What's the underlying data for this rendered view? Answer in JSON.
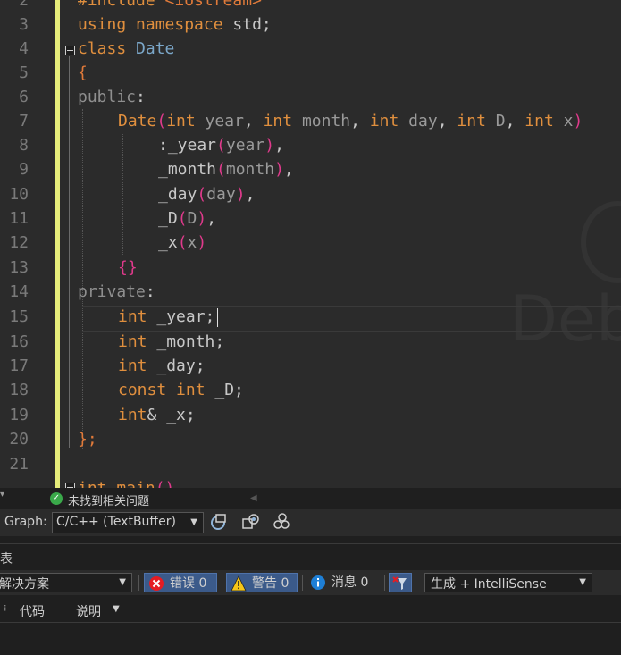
{
  "editor": {
    "lines": [
      {
        "n": "2"
      },
      {
        "n": "3"
      },
      {
        "n": "4"
      },
      {
        "n": "5"
      },
      {
        "n": "6"
      },
      {
        "n": "7"
      },
      {
        "n": "8"
      },
      {
        "n": "9"
      },
      {
        "n": "10"
      },
      {
        "n": "11"
      },
      {
        "n": "12"
      },
      {
        "n": "13"
      },
      {
        "n": "14"
      },
      {
        "n": "15"
      },
      {
        "n": "16"
      },
      {
        "n": "17"
      },
      {
        "n": "18"
      },
      {
        "n": "19"
      },
      {
        "n": "20"
      },
      {
        "n": "21"
      }
    ],
    "tokens": {
      "l2_a": "#include",
      "l2_b": " <iostream>",
      "l3_a": "using",
      "l3_b": " namespace",
      "l3_c": " std;",
      "l4_a": "class",
      "l4_b": " Date",
      "l5_a": "{",
      "l6_a": "public",
      "l6_b": ":",
      "l7_a": "Date",
      "l7_b": "(",
      "l7_c": "int",
      "l7_d": " year",
      "l7_e": ", ",
      "l7_f": "int",
      "l7_g": " month",
      "l7_h": ", ",
      "l7_i": "int",
      "l7_j": " day",
      "l7_k": ", ",
      "l7_l": "int",
      "l7_m": " D",
      "l7_n": ", ",
      "l7_o": "int",
      "l7_p": " x",
      "l7_q": ")",
      "l8_a": ":_year",
      "l8_b": "(",
      "l8_c": "year",
      "l8_d": ")",
      "l8_e": ",",
      "l9_a": "_month",
      "l9_b": "(",
      "l9_c": "month",
      "l9_d": ")",
      "l9_e": ",",
      "l10_a": "_day",
      "l10_b": "(",
      "l10_c": "day",
      "l10_d": ")",
      "l10_e": ",",
      "l11_a": "_D",
      "l11_b": "(",
      "l11_c": "D",
      "l11_d": ")",
      "l11_e": ",",
      "l12_a": "_x",
      "l12_b": "(",
      "l12_c": "x",
      "l12_d": ")",
      "l13_a": "{}",
      "l14_a": "private",
      "l14_b": ":",
      "l15_a": "int",
      "l15_b": " _year;",
      "l16_a": "int",
      "l16_b": " _month;",
      "l17_a": "int",
      "l17_b": " _day;",
      "l18_a": "const",
      "l18_b": " int",
      "l18_c": " _D;",
      "l19_a": "int",
      "l19_b": "&",
      "l19_c": " _x;",
      "l20_a": "};",
      "l22_a": "int",
      "l22_b": " main",
      "l22_c": "()"
    },
    "watermark": "Deb"
  },
  "status": {
    "message": "未找到相关问题"
  },
  "graph": {
    "label": "Graph:",
    "selected": "C/C++ (TextBuffer)"
  },
  "panel": {
    "title": "表"
  },
  "errors": {
    "scope": "解决方案",
    "errors_label": "错误 0",
    "warnings_label": "警告 0",
    "messages_label": "消息 0",
    "build_filter": "生成 + IntelliSense",
    "col_code": "代码",
    "col_desc": "说明"
  },
  "colors": {
    "keyword": "#e08f3e",
    "class_name": "#7ba7c9",
    "paren": "#e03a8c",
    "change_bar": "#e6ec7a"
  }
}
